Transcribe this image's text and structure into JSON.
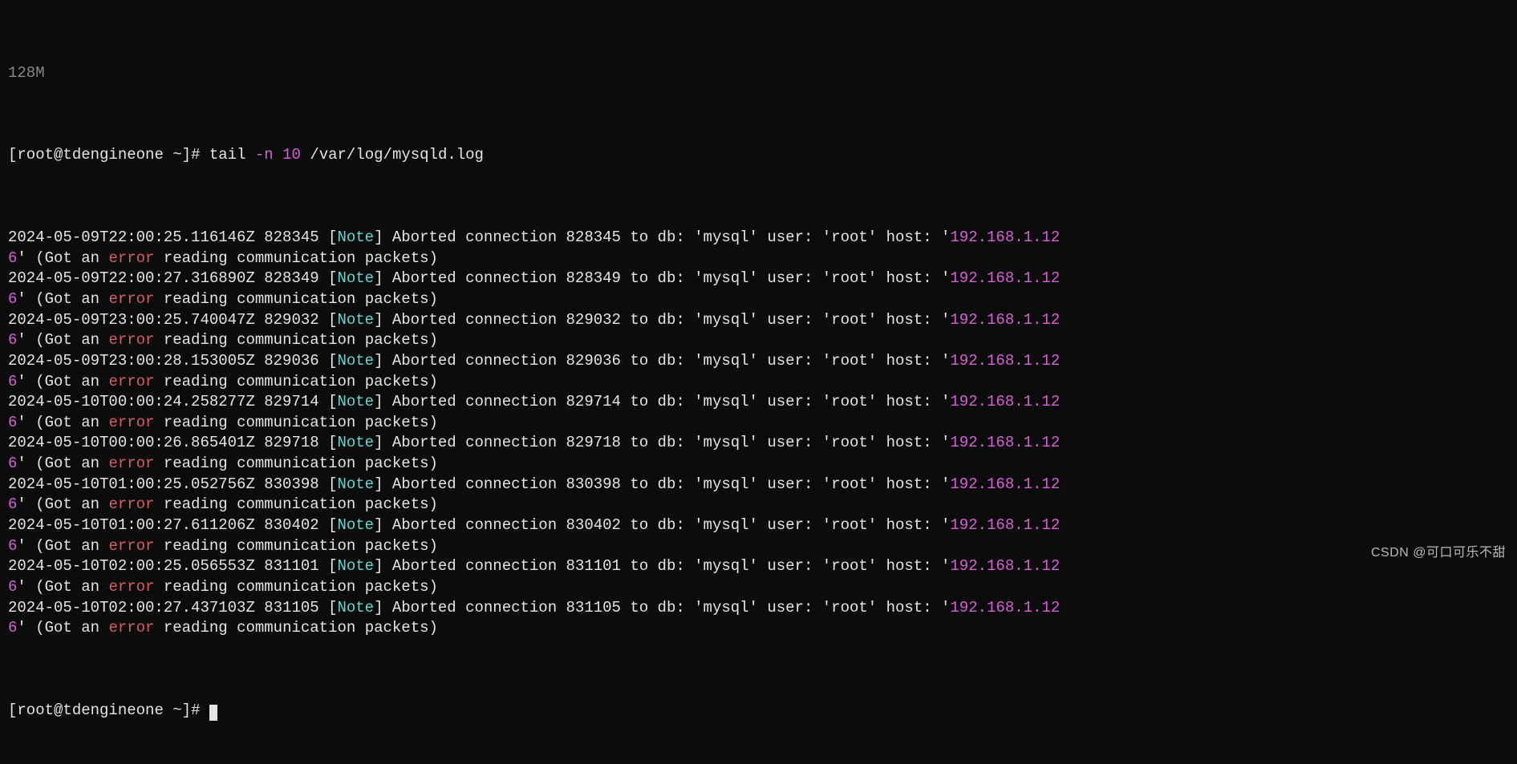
{
  "top_fragment": "128M",
  "prompt": {
    "user": "root",
    "host": "tdengineone",
    "cwd_symbol": "~",
    "sigil": "#"
  },
  "command": {
    "cmd": "tail",
    "arg_flag": "-n",
    "arg_n": "10",
    "path": "/var/log/mysqld.log"
  },
  "log": {
    "note_label": "Note",
    "error_word": "error",
    "msg_prefix": "Aborted connection",
    "msg_mid": "to db:",
    "db_literal": "'mysql'",
    "user_label": "user:",
    "user_literal": "'root'",
    "host_label": "host:",
    "ip_prefix": "192.168.1.12",
    "ip_tail": "6",
    "tail_open": "' (Got an",
    "tail_close": "reading communication packets)"
  },
  "entries": [
    {
      "ts": "2024-05-09T22:00:25.116146Z",
      "id": "828345",
      "conn": "828345"
    },
    {
      "ts": "2024-05-09T22:00:27.316890Z",
      "id": "828349",
      "conn": "828349"
    },
    {
      "ts": "2024-05-09T23:00:25.740047Z",
      "id": "829032",
      "conn": "829032"
    },
    {
      "ts": "2024-05-09T23:00:28.153005Z",
      "id": "829036",
      "conn": "829036"
    },
    {
      "ts": "2024-05-10T00:00:24.258277Z",
      "id": "829714",
      "conn": "829714"
    },
    {
      "ts": "2024-05-10T00:00:26.865401Z",
      "id": "829718",
      "conn": "829718"
    },
    {
      "ts": "2024-05-10T01:00:25.052756Z",
      "id": "830398",
      "conn": "830398"
    },
    {
      "ts": "2024-05-10T01:00:27.611206Z",
      "id": "830402",
      "conn": "830402"
    },
    {
      "ts": "2024-05-10T02:00:25.056553Z",
      "id": "831101",
      "conn": "831101"
    },
    {
      "ts": "2024-05-10T02:00:27.437103Z",
      "id": "831105",
      "conn": "831105"
    }
  ],
  "watermark": "CSDN @可口可乐不甜"
}
